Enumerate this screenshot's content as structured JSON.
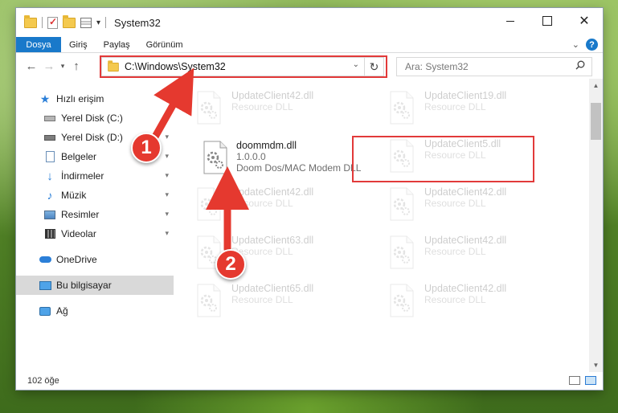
{
  "window": {
    "title": "System32",
    "controls": {
      "minimize": "",
      "maximize": "",
      "close": "✕"
    }
  },
  "ribbon": {
    "tabs": [
      "Dosya",
      "Giriş",
      "Paylaş",
      "Görünüm"
    ],
    "collapse_icon": "chevron-down-icon",
    "help_label": "?"
  },
  "nav": {
    "back": "←",
    "forward": "→",
    "recent": "▾",
    "up": "↑",
    "address": "C:\\Windows\\System32",
    "refresh": "↻",
    "search_placeholder": "Ara: System32"
  },
  "sidebar": {
    "quick_access": "Hızlı erişim",
    "items": [
      {
        "label": "Yerel Disk (C:)",
        "icon": "drive-icon",
        "pinned": true
      },
      {
        "label": "Yerel Disk (D:)",
        "icon": "drive-icon",
        "pinned": true
      },
      {
        "label": "Belgeler",
        "icon": "documents-icon",
        "pinned": true
      },
      {
        "label": "İndirmeler",
        "icon": "downloads-icon",
        "pinned": true
      },
      {
        "label": "Müzik",
        "icon": "music-icon",
        "pinned": true
      },
      {
        "label": "Resimler",
        "icon": "pictures-icon",
        "pinned": true
      },
      {
        "label": "Videolar",
        "icon": "videos-icon",
        "pinned": true
      }
    ],
    "onedrive": "OneDrive",
    "this_pc": "Bu bilgisayar",
    "network": "Ağ",
    "pin_glyph": "📌"
  },
  "files": {
    "selected": {
      "name": "doommdm.dll",
      "version": "1.0.0.0",
      "description": "Doom Dos/MAC Modem DLL"
    },
    "ghost": [
      {
        "name": "UpdateClient42.dll",
        "type": "Resource DLL"
      },
      {
        "name": "UpdateClient19.dll",
        "type": "Resource DLL"
      },
      {
        "name": "UpdateClient5.dll",
        "type": "Resource DLL"
      },
      {
        "name": "UpdateClient42.dll",
        "type": "Resource DLL"
      },
      {
        "name": "UpdateClient42.dll",
        "type": "Resource DLL"
      },
      {
        "name": "UpdateClient63.dll",
        "type": "Resource DLL"
      },
      {
        "name": "UpdateClient42.dll",
        "type": "Resource DLL"
      },
      {
        "name": "UpdateClient65.dll",
        "type": "Resource DLL"
      },
      {
        "name": "UpdateClient42.dll",
        "type": "Resource DLL"
      }
    ]
  },
  "status": {
    "item_count": "102 öğe"
  },
  "annotations": {
    "step1": "1",
    "step2": "2",
    "color": "#e5392f"
  },
  "colors": {
    "accent": "#1979ca",
    "highlight": "#e23a3a",
    "selection": "#cce8ff"
  }
}
